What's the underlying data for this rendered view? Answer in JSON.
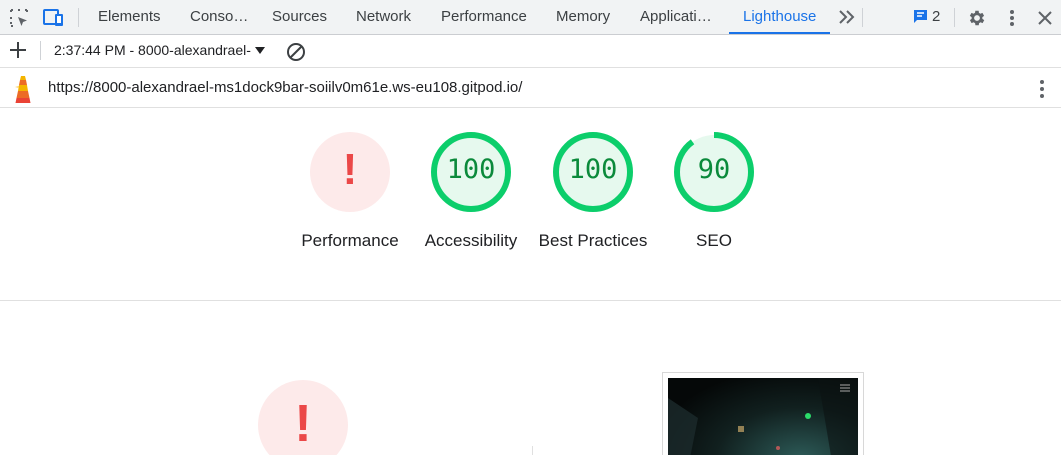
{
  "devtools": {
    "tabs": [
      {
        "label": "Elements",
        "active": false
      },
      {
        "label": "Conso…",
        "active": false
      },
      {
        "label": "Sources",
        "active": false
      },
      {
        "label": "Network",
        "active": false
      },
      {
        "label": "Performance",
        "active": false
      },
      {
        "label": "Memory",
        "active": false
      },
      {
        "label": "Applicati…",
        "active": false
      },
      {
        "label": "Lighthouse",
        "active": true
      }
    ],
    "issues_count": "2",
    "icons": [
      "inspect-element-icon",
      "device-toolbar-icon",
      "more-tabs-icon",
      "issues-icon",
      "settings-gear-icon",
      "more-vert-icon",
      "close-icon"
    ]
  },
  "toolbar": {
    "report_label": "2:37:44 PM - 8000-alexandrael-",
    "icons": [
      "add-icon",
      "dropdown-caret-icon",
      "clear-block-icon"
    ]
  },
  "report": {
    "url": "https://8000-alexandrael-ms1dock9bar-soiilv0m61e.ws-eu108.gitpod.io/",
    "gauges": [
      {
        "label": "Performance",
        "value": "!",
        "status": "error",
        "score": null
      },
      {
        "label": "Accessibility",
        "value": "100",
        "status": "pass",
        "score": 100
      },
      {
        "label": "Best Practices",
        "value": "100",
        "status": "pass",
        "score": 100
      },
      {
        "label": "SEO",
        "value": "90",
        "status": "pass",
        "score": 90
      }
    ],
    "main_gauge": {
      "value": "!",
      "status": "error"
    }
  },
  "colors": {
    "pass": "#0cce6b",
    "pass_fill": "#e6f9ee",
    "pass_text": "#0b8a3b",
    "error": "#eb4848",
    "error_fill": "#fdeaea",
    "accent": "#1a73e8"
  }
}
